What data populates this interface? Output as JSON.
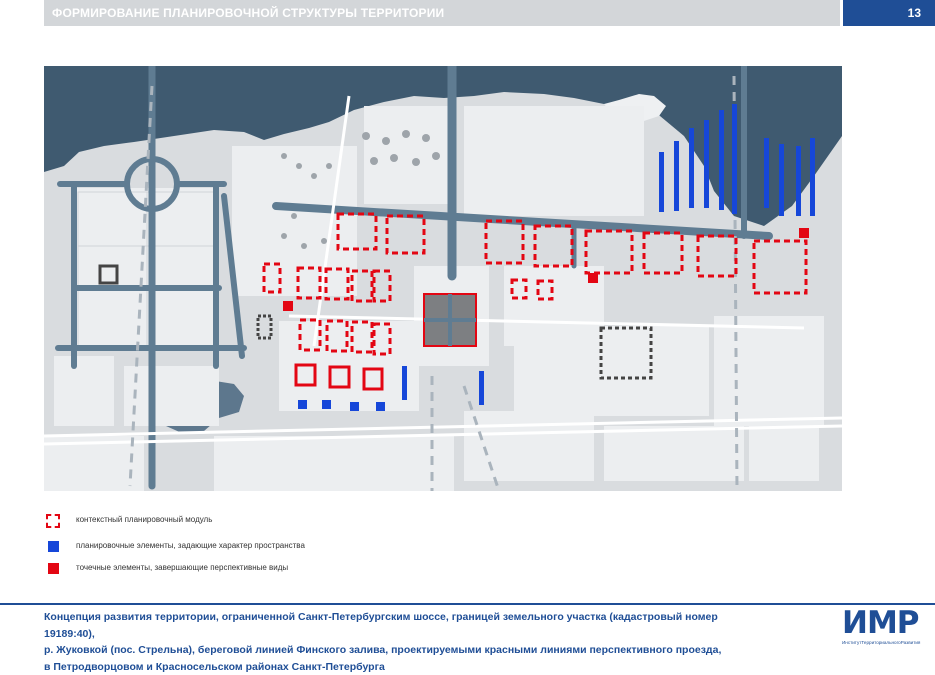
{
  "header": {
    "title": "ФОРМИРОВАНИЕ ПЛАНИРОВОЧНОЙ СТРУКТУРЫ ТЕРРИТОРИИ",
    "page_number": "13",
    "accent_color": "#1f4e96"
  },
  "map": {
    "colors": {
      "sea": "#3f5a70",
      "land": "#d9dcdf",
      "block": "#eceef0",
      "road_main": "#5f7c92",
      "road_minor": "#ffffff",
      "module_red": "#e30613",
      "element_blue": "#1647d9",
      "central_square": "#7d7f82"
    }
  },
  "legend": [
    {
      "label": "контекстный планировочный модуль",
      "symbol": "red-dashed-square"
    },
    {
      "label": "планировочные элементы, задающие характер пространства",
      "symbol": "blue-square"
    },
    {
      "label": "точечные элементы, завершающие перспективные виды",
      "symbol": "red-square"
    }
  ],
  "footer": {
    "line1": "Концепция развития территории, ограниченной Санкт-Петербургским шоссе, границей земельного участка (кадастровый номер 19189:40),",
    "line2": "р. Жуковкой (пос. Стрельна), береговой линией Финского залива, проектируемыми красными линиями перспективного проезда,",
    "line3": "в Петродворцовом и Красносельском районах Санкт-Петербурга"
  },
  "logo": {
    "letters": "ИМР",
    "subtitle": "ИнститутТерриториальногоРазвития"
  }
}
